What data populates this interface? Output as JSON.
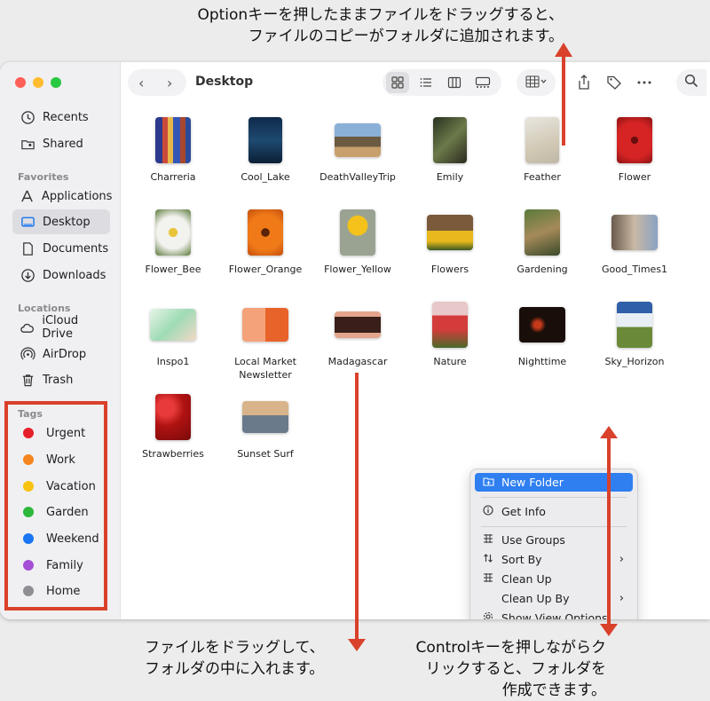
{
  "callouts": {
    "top": [
      "Optionキーを押したままファイルをドラッグすると、",
      "ファイルのコピーがフォルダに追加されます。"
    ],
    "bottom_left": [
      "ファイルをドラッグして、",
      "フォルダの中に入れます。"
    ],
    "bottom_right": [
      "Controlキーを押しながらク",
      "リックすると、フォルダを",
      "作成できます。"
    ]
  },
  "window": {
    "title": "Desktop"
  },
  "sidebar": {
    "recents": "Recents",
    "shared": "Shared",
    "favorites_header": "Favorites",
    "favorites": [
      "Applications",
      "Desktop",
      "Documents",
      "Downloads"
    ],
    "locations_header": "Locations",
    "locations": [
      "iCloud Drive",
      "AirDrop",
      "Trash"
    ],
    "tags_header": "Tags",
    "tags": [
      {
        "label": "Urgent",
        "color": "#e5202a"
      },
      {
        "label": "Work",
        "color": "#f5851f"
      },
      {
        "label": "Vacation",
        "color": "#f7c211"
      },
      {
        "label": "Garden",
        "color": "#2cb83b"
      },
      {
        "label": "Weekend",
        "color": "#1a76f2"
      },
      {
        "label": "Family",
        "color": "#a54fd6"
      },
      {
        "label": "Home",
        "color": "#8e8e93"
      }
    ]
  },
  "files": [
    {
      "label": "Charreria"
    },
    {
      "label": "Cool_Lake"
    },
    {
      "label": "DeathValleyTrip"
    },
    {
      "label": "Emily"
    },
    {
      "label": "Feather"
    },
    {
      "label": "Flower"
    },
    {
      "label": "Flower_Bee"
    },
    {
      "label": "Flower_Orange"
    },
    {
      "label": "Flower_Yellow"
    },
    {
      "label": "Flowers"
    },
    {
      "label": "Gardening"
    },
    {
      "label": "Good_Times1"
    },
    {
      "label": "Inspo1"
    },
    {
      "label": "Local Market Newsletter"
    },
    {
      "label": "Madagascar"
    },
    {
      "label": "Nature"
    },
    {
      "label": "Nighttime"
    },
    {
      "label": "Sky_Horizon"
    },
    {
      "label": "Strawberries"
    },
    {
      "label": "Sunset Surf"
    }
  ],
  "context_menu": {
    "new_folder": "New Folder",
    "get_info": "Get Info",
    "use_groups": "Use Groups",
    "sort_by": "Sort By",
    "clean_up": "Clean Up",
    "clean_up_by": "Clean Up By",
    "show_view_options": "Show View Options"
  },
  "accent": "#d9412b"
}
